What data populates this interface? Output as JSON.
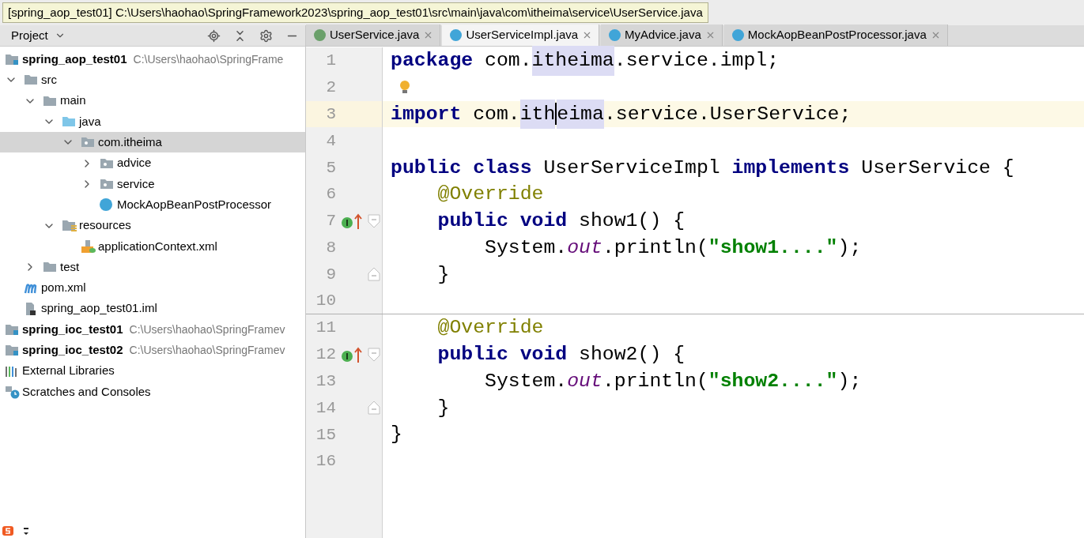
{
  "tooltip": "[spring_aop_test01] C:\\Users\\haohao\\SpringFramework2023\\spring_aop_test01\\src\\main\\java\\com\\itheima\\service\\UserService.java",
  "project_panel": {
    "title": "Project",
    "tree": [
      {
        "label": "spring_aop_test01",
        "path": "C:\\Users\\haohao\\SpringFrame",
        "kind": "module",
        "selected": false,
        "children": [
          {
            "label": "src",
            "kind": "folder",
            "expanded": true,
            "selected": false,
            "children": [
              {
                "label": "main",
                "kind": "folder",
                "expanded": true,
                "selected": false,
                "children": [
                  {
                    "label": "java",
                    "kind": "source",
                    "expanded": true,
                    "selected": false,
                    "children": [
                      {
                        "label": "com.itheima",
                        "kind": "package",
                        "expanded": true,
                        "selected": true,
                        "children": [
                          {
                            "label": "advice",
                            "kind": "package",
                            "expanded": false,
                            "selected": false
                          },
                          {
                            "label": "service",
                            "kind": "package",
                            "expanded": false,
                            "selected": false
                          },
                          {
                            "label": "MockAopBeanPostProcessor",
                            "kind": "class",
                            "selected": false
                          }
                        ]
                      }
                    ]
                  },
                  {
                    "label": "resources",
                    "kind": "resources",
                    "expanded": true,
                    "selected": false,
                    "children": [
                      {
                        "label": "applicationContext.xml",
                        "kind": "xml",
                        "selected": false
                      }
                    ]
                  }
                ]
              },
              {
                "label": "test",
                "kind": "folder",
                "expanded": false,
                "selected": false
              }
            ]
          },
          {
            "label": "pom.xml",
            "kind": "pom",
            "selected": false
          },
          {
            "label": "spring_aop_test01.iml",
            "kind": "iml",
            "selected": false
          }
        ]
      },
      {
        "label": "spring_ioc_test01",
        "path": "C:\\Users\\haohao\\SpringFramev",
        "kind": "module",
        "selected": false
      },
      {
        "label": "spring_ioc_test02",
        "path": "C:\\Users\\haohao\\SpringFramev",
        "kind": "module",
        "selected": false
      },
      {
        "label": "External Libraries",
        "kind": "libraries",
        "selected": false
      },
      {
        "label": "Scratches and Consoles",
        "kind": "scratches",
        "selected": false
      }
    ]
  },
  "tabs": [
    {
      "label": "UserService.java",
      "kind": "interface",
      "selected": false
    },
    {
      "label": "UserServiceImpl.java",
      "kind": "class",
      "selected": true
    },
    {
      "label": "MyAdvice.java",
      "kind": "class",
      "selected": false
    },
    {
      "label": "MockAopBeanPostProcessor.java",
      "kind": "class",
      "selected": false
    }
  ],
  "editor": {
    "lines": [
      {
        "number": "1",
        "current": false,
        "tokens": [
          {
            "text": "package",
            "kind": "keyword"
          },
          {
            "text": " com.",
            "kind": "plain"
          },
          {
            "text": "itheima",
            "kind": "highlight"
          },
          {
            "text": ".service.impl;",
            "kind": "plain"
          }
        ]
      },
      {
        "number": "2",
        "current": false,
        "bulb": true
      },
      {
        "number": "3",
        "current": true,
        "tokens": [
          {
            "text": "import",
            "kind": "keyword"
          },
          {
            "text": " com.",
            "kind": "plain"
          },
          {
            "text": "ith",
            "kind": "highlight"
          },
          {
            "kind": "caret"
          },
          {
            "text": "eima",
            "kind": "highlight"
          },
          {
            "text": ".service.UserService;",
            "kind": "plain"
          }
        ]
      },
      {
        "number": "4",
        "current": false
      },
      {
        "number": "5",
        "current": false,
        "tokens": [
          {
            "text": "public class",
            "kind": "keyword"
          },
          {
            "text": " UserServiceImpl ",
            "kind": "plain"
          },
          {
            "text": "implements",
            "kind": "keyword"
          },
          {
            "text": " UserService {",
            "kind": "plain"
          }
        ]
      },
      {
        "number": "6",
        "current": false,
        "tokens": [
          {
            "text": "    @Override",
            "kind": "annotation"
          }
        ]
      },
      {
        "number": "7",
        "current": false,
        "implements_marker": true,
        "fold_start": true,
        "tokens": [
          {
            "text": "    public void",
            "kind": "keyword"
          },
          {
            "text": " show1() {",
            "kind": "plain"
          }
        ]
      },
      {
        "number": "8",
        "current": false,
        "tokens": [
          {
            "text": "        System.",
            "kind": "plain"
          },
          {
            "text": "out",
            "kind": "static"
          },
          {
            "text": ".println(",
            "kind": "plain"
          },
          {
            "text": "\"show1....\"",
            "kind": "string"
          },
          {
            "text": ");",
            "kind": "plain"
          }
        ]
      },
      {
        "number": "9",
        "current": false,
        "fold_end": true,
        "tokens": [
          {
            "text": "    }",
            "kind": "plain"
          }
        ]
      },
      {
        "number": "10",
        "current": false,
        "separator": true
      },
      {
        "number": "11",
        "current": false,
        "tokens": [
          {
            "text": "    @Override",
            "kind": "annotation"
          }
        ]
      },
      {
        "number": "12",
        "current": false,
        "implements_marker": true,
        "fold_start": true,
        "tokens": [
          {
            "text": "    public void",
            "kind": "keyword"
          },
          {
            "text": " show2() {",
            "kind": "plain"
          }
        ]
      },
      {
        "number": "13",
        "current": false,
        "tokens": [
          {
            "text": "        System.",
            "kind": "plain"
          },
          {
            "text": "out",
            "kind": "static"
          },
          {
            "text": ".println(",
            "kind": "plain"
          },
          {
            "text": "\"show2....\"",
            "kind": "string"
          },
          {
            "text": ");",
            "kind": "plain"
          }
        ]
      },
      {
        "number": "14",
        "current": false,
        "fold_end": true,
        "tokens": [
          {
            "text": "    }",
            "kind": "plain"
          }
        ]
      },
      {
        "number": "15",
        "current": false,
        "tokens": [
          {
            "text": "}",
            "kind": "plain"
          }
        ]
      },
      {
        "number": "16",
        "current": false
      }
    ]
  }
}
